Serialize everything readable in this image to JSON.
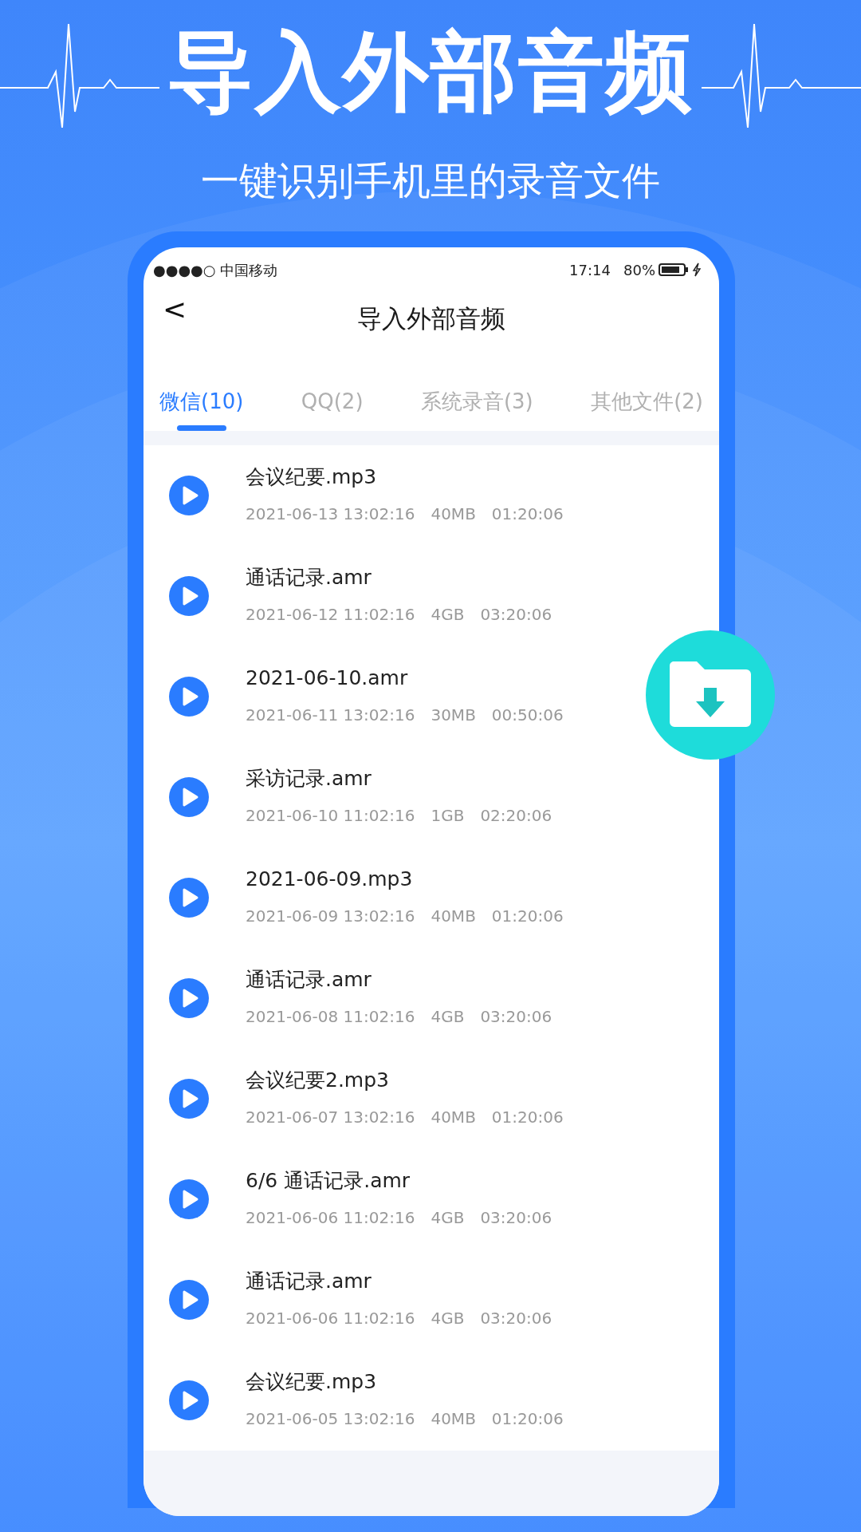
{
  "headline": "导入外部音频",
  "subheadline": "一键识别手机里的录音文件",
  "status_bar": {
    "carrier": "●●●●○ 中国移动",
    "time": "17:14",
    "battery": "80%"
  },
  "nav": {
    "back": "<",
    "title": "导入外部音频"
  },
  "tabs": [
    {
      "label": "微信(10)",
      "selected": true
    },
    {
      "label": "QQ(2)",
      "selected": false
    },
    {
      "label": "系统录音(3)",
      "selected": false
    },
    {
      "label": "其他文件(2)",
      "selected": false
    }
  ],
  "files": [
    {
      "name": "会议纪要.mp3",
      "date": "2021-06-13 13:02:16",
      "size": "40MB",
      "duration": "01:20:06"
    },
    {
      "name": "通话记录.amr",
      "date": "2021-06-12 11:02:16",
      "size": "4GB",
      "duration": "03:20:06"
    },
    {
      "name": "2021-06-10.amr",
      "date": "2021-06-11 13:02:16",
      "size": "30MB",
      "duration": "00:50:06"
    },
    {
      "name": "采访记录.amr",
      "date": "2021-06-10 11:02:16",
      "size": "1GB",
      "duration": "02:20:06"
    },
    {
      "name": "2021-06-09.mp3",
      "date": "2021-06-09 13:02:16",
      "size": "40MB",
      "duration": "01:20:06"
    },
    {
      "name": "通话记录.amr",
      "date": "2021-06-08 11:02:16",
      "size": "4GB",
      "duration": "03:20:06"
    },
    {
      "name": "会议纪要2.mp3",
      "date": "2021-06-07 13:02:16",
      "size": "40MB",
      "duration": "01:20:06"
    },
    {
      "name": "6/6 通话记录.amr",
      "date": "2021-06-06 11:02:16",
      "size": "4GB",
      "duration": "03:20:06"
    },
    {
      "name": "通话记录.amr",
      "date": "2021-06-06 11:02:16",
      "size": "4GB",
      "duration": "03:20:06"
    },
    {
      "name": "会议纪要.mp3",
      "date": "2021-06-05 13:02:16",
      "size": "40MB",
      "duration": "01:20:06"
    }
  ]
}
